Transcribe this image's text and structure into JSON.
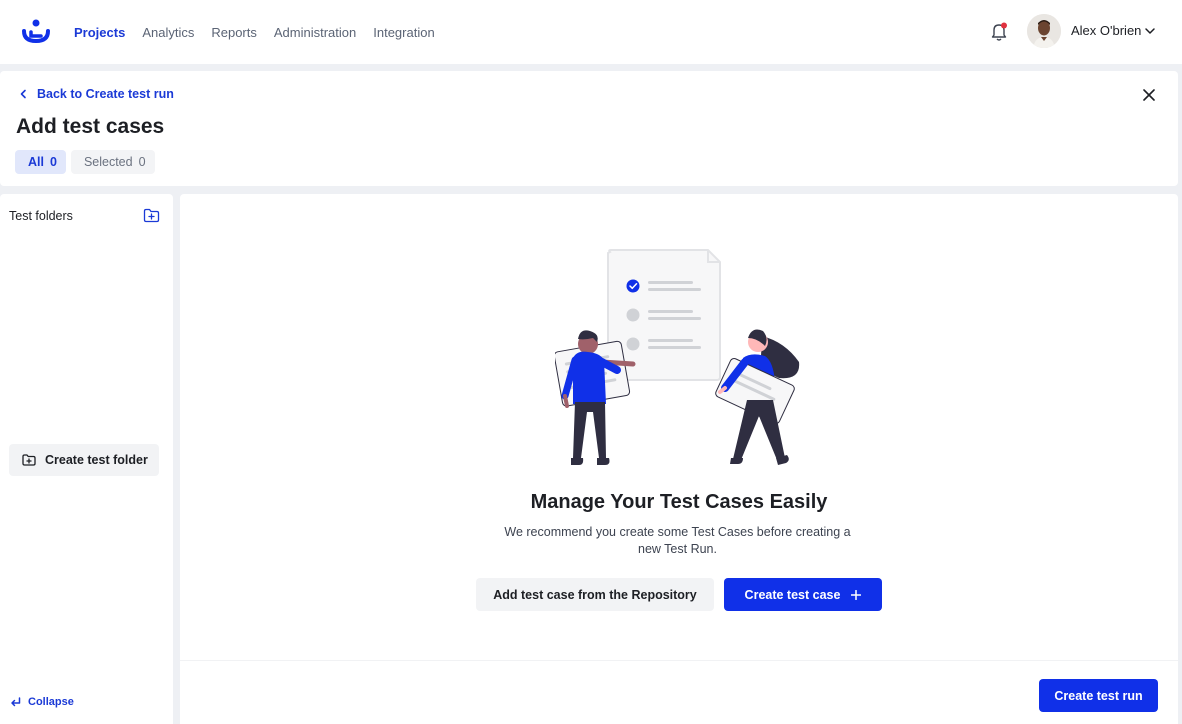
{
  "nav": {
    "items": [
      {
        "label": "Projects",
        "active": true
      },
      {
        "label": "Analytics",
        "active": false
      },
      {
        "label": "Reports",
        "active": false
      },
      {
        "label": "Administration",
        "active": false
      },
      {
        "label": "Integration",
        "active": false
      }
    ]
  },
  "user": {
    "name": "Alex O'brien",
    "notifications_unread": true
  },
  "header": {
    "back_label": "Back to Create test run",
    "title": "Add test cases",
    "tabs": [
      {
        "label": "All",
        "count": "0",
        "active": true
      },
      {
        "label": "Selected",
        "count": "0",
        "active": false
      }
    ]
  },
  "sidebar": {
    "title": "Test folders",
    "create_folder_label": "Create test folder",
    "collapse_label": "Collapse"
  },
  "empty_state": {
    "title": "Manage Your Test Cases Easily",
    "description": "We recommend you create some Test Cases before creating a new Test Run.",
    "repo_button_label": "Add test case from the Repository",
    "create_case_button_label": "Create test case"
  },
  "footer": {
    "create_run_label": "Create test run"
  },
  "colors": {
    "accent": "#1030e8",
    "link": "#1b3ad6",
    "tab_active_bg": "#e1e7fb",
    "notification_dot": "#e0313f"
  },
  "icons": [
    "app-logo-icon",
    "bell-icon",
    "chevron-down-icon",
    "chevron-left-icon",
    "close-icon",
    "folder-plus-icon",
    "plus-icon",
    "collapse-arrow-icon"
  ]
}
